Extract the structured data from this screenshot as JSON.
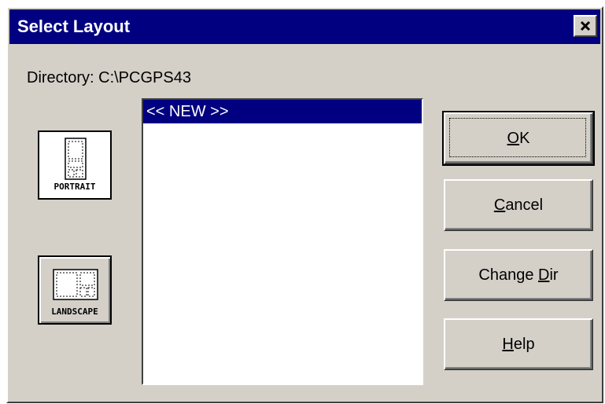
{
  "window": {
    "title": "Select Layout",
    "close_glyph": "✕"
  },
  "directory": {
    "label": "Directory: C:\\PCGPS43"
  },
  "layouts": [
    {
      "label": "PORTRAIT",
      "icon": "portrait-page-icon",
      "selected": true
    },
    {
      "label": "LANDSCAPE",
      "icon": "landscape-page-icon",
      "selected": false
    }
  ],
  "list": {
    "items": [
      "<< NEW >>"
    ],
    "selected_index": 0
  },
  "buttons": {
    "ok": {
      "pre": "",
      "key": "O",
      "post": "K"
    },
    "cancel": {
      "pre": "",
      "key": "C",
      "post": "ancel"
    },
    "change_dir": {
      "pre": "Change ",
      "key": "D",
      "post": "ir"
    },
    "help": {
      "pre": "",
      "key": "H",
      "post": "elp"
    }
  },
  "colors": {
    "titlebar": "#000080",
    "face": "#d4d0c8",
    "selection": "#000080"
  }
}
